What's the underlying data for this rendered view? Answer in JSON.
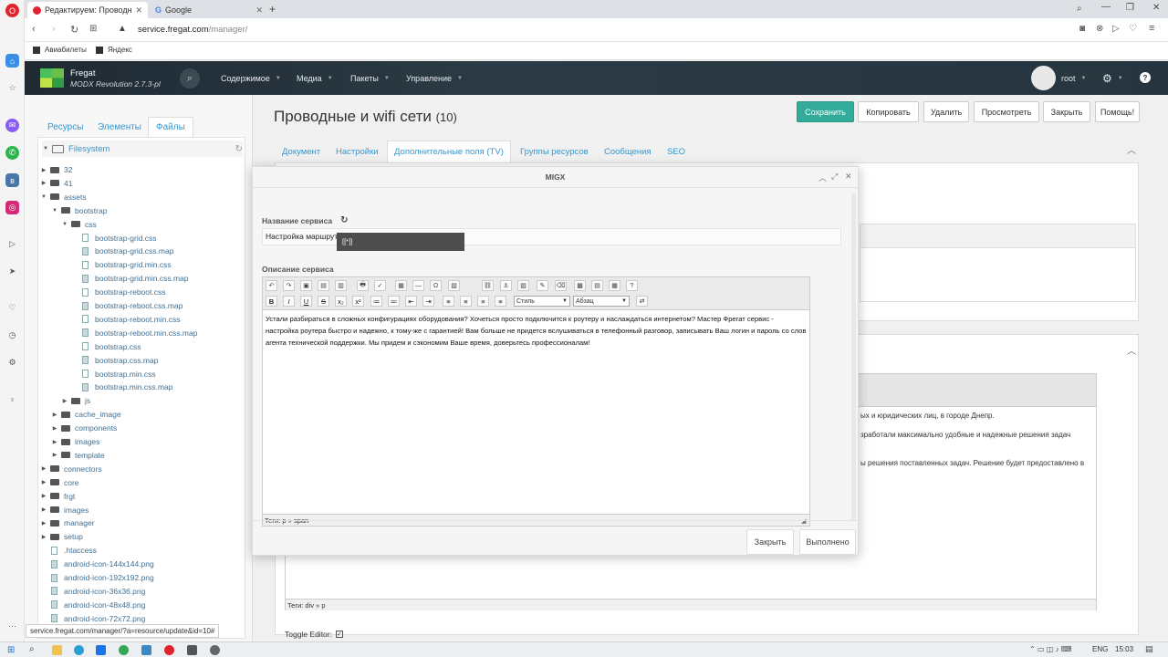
{
  "browser": {
    "tabs": [
      {
        "label": "Редактируем: Проводные"
      },
      {
        "label": "Google"
      }
    ],
    "new_tab": "+",
    "url_host": "service.fregat.com",
    "url_path": "/manager/",
    "bookmarks": [
      "Авиабилеты",
      "Яндекс"
    ],
    "status_url": "service.fregat.com/manager/?a=resource/update&id=10#"
  },
  "header": {
    "brand": "Fregat",
    "version": "MODX Revolution 2.7.3-pl",
    "nav": [
      "Содержимое",
      "Медиа",
      "Пакеты",
      "Управление"
    ],
    "user": "root"
  },
  "tree": {
    "tabs": [
      "Ресурсы",
      "Элементы",
      "Файлы"
    ],
    "root": "Filesystem",
    "items": [
      {
        "label": "32",
        "depth": 0,
        "type": "folder",
        "open": false
      },
      {
        "label": "41",
        "depth": 0,
        "type": "folder",
        "open": false
      },
      {
        "label": "assets",
        "depth": 0,
        "type": "folder",
        "open": true
      },
      {
        "label": "bootstrap",
        "depth": 1,
        "type": "folder",
        "open": true
      },
      {
        "label": "css",
        "depth": 2,
        "type": "folder",
        "open": true
      },
      {
        "label": "bootstrap-grid.css",
        "depth": 3,
        "type": "file"
      },
      {
        "label": "bootstrap-grid.css.map",
        "depth": 3,
        "type": "map"
      },
      {
        "label": "bootstrap-grid.min.css",
        "depth": 3,
        "type": "file"
      },
      {
        "label": "bootstrap-grid.min.css.map",
        "depth": 3,
        "type": "map"
      },
      {
        "label": "bootstrap-reboot.css",
        "depth": 3,
        "type": "file"
      },
      {
        "label": "bootstrap-reboot.css.map",
        "depth": 3,
        "type": "map"
      },
      {
        "label": "bootstrap-reboot.min.css",
        "depth": 3,
        "type": "file"
      },
      {
        "label": "bootstrap-reboot.min.css.map",
        "depth": 3,
        "type": "map"
      },
      {
        "label": "bootstrap.css",
        "depth": 3,
        "type": "file"
      },
      {
        "label": "bootstrap.css.map",
        "depth": 3,
        "type": "map"
      },
      {
        "label": "bootstrap.min.css",
        "depth": 3,
        "type": "file"
      },
      {
        "label": "bootstrap.min.css.map",
        "depth": 3,
        "type": "map"
      },
      {
        "label": "js",
        "depth": 2,
        "type": "folder",
        "open": false
      },
      {
        "label": "cache_image",
        "depth": 1,
        "type": "folder",
        "open": false
      },
      {
        "label": "components",
        "depth": 1,
        "type": "folder",
        "open": false
      },
      {
        "label": "images",
        "depth": 1,
        "type": "folder",
        "open": false
      },
      {
        "label": "template",
        "depth": 1,
        "type": "folder",
        "open": false
      },
      {
        "label": "connectors",
        "depth": 0,
        "type": "folder",
        "open": false
      },
      {
        "label": "core",
        "depth": 0,
        "type": "folder",
        "open": false
      },
      {
        "label": "frgt",
        "depth": 0,
        "type": "folder",
        "open": false
      },
      {
        "label": "images",
        "depth": 0,
        "type": "folder",
        "open": false
      },
      {
        "label": "manager",
        "depth": 0,
        "type": "folder",
        "open": false
      },
      {
        "label": "setup",
        "depth": 0,
        "type": "folder",
        "open": false
      },
      {
        "label": ".htaccess",
        "depth": 0,
        "type": "file"
      },
      {
        "label": "android-icon-144x144.png",
        "depth": 0,
        "type": "image"
      },
      {
        "label": "android-icon-192x192.png",
        "depth": 0,
        "type": "image"
      },
      {
        "label": "android-icon-36x36.png",
        "depth": 0,
        "type": "image"
      },
      {
        "label": "android-icon-48x48.png",
        "depth": 0,
        "type": "image"
      },
      {
        "label": "android-icon-72x72.png",
        "depth": 0,
        "type": "image"
      }
    ]
  },
  "page": {
    "title": "Проводные и wifi сети",
    "id": "(10)",
    "actions": [
      "Сохранить",
      "Копировать",
      "Удалить",
      "Просмотреть",
      "Закрыть",
      "Помощь!"
    ],
    "tabs": [
      "Документ",
      "Настройки",
      "Дополнительные поля (TV)",
      "Группы ресурсов",
      "Сообщения",
      "SEO"
    ],
    "bg_line1": "ых и юридических лиц, в городе Днепр.",
    "bg_line2": "зработали максимально удобные и надежные решения задач",
    "bg_line3": "ы решения поставленных задач. Решение будет предоставлено в",
    "bg_tags": "Теги: div » p",
    "toggle_editor": "Toggle Editor:"
  },
  "modal": {
    "title": "MIGX",
    "field1_label": "Название сервиса",
    "field1_value": "Настройка маршрут",
    "tooltip": "[[*]]",
    "field2_label": "Описание сервиса",
    "style_select": "Стиль",
    "format_select": "Абзац",
    "editor_text": "Устали разбираться в сложных конфигурациях оборудования? Хочеться просто подключится к роутеру и наслаждаться интернетом? Мастер Фрегат сервис - настройка роутера быстро и надежно, к тому-же с гарантией! Вам больше не придется вслушиваться в телефонный разговор, записывать Ваш логин и пароль со слов агента технической поддержки. Мы придем и сэкономим Ваше время, доверьтесь профессионалам!",
    "tags_path": "Теги: p » span",
    "close_btn": "Закрыть",
    "done_btn": "Выполнено"
  },
  "taskbar": {
    "lang": "ENG",
    "time": "15:03"
  },
  "colors": {
    "accent": "#3697cd",
    "save": "#32ab9a",
    "header": "#273540"
  }
}
